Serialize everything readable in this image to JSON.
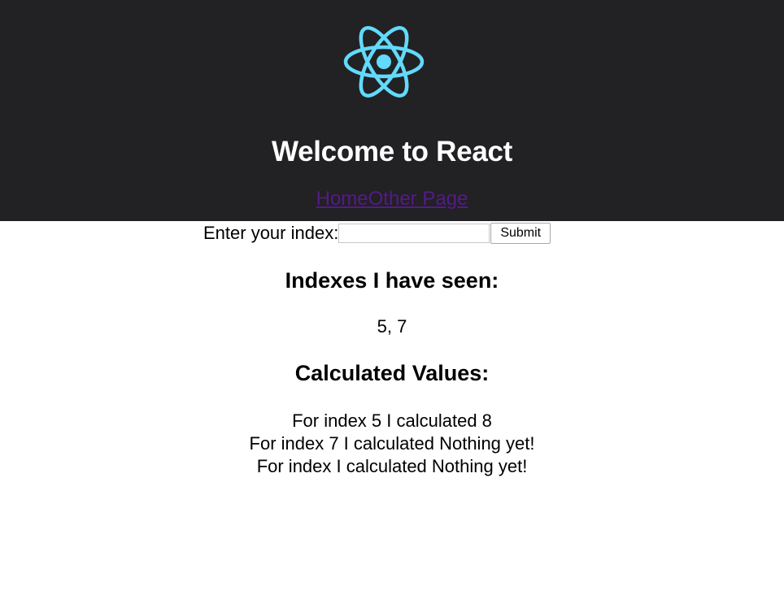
{
  "header": {
    "logo_icon": "react-logo-icon",
    "logo_color": "#61dafb",
    "background_color": "#222123",
    "title": "Welcome to React"
  },
  "nav": {
    "links": [
      "Home",
      "Other Page"
    ],
    "link_color": "#551a8b"
  },
  "form": {
    "label": "Enter your index:",
    "input_value": "",
    "input_placeholder": "",
    "submit_label": "Submit"
  },
  "indexes": {
    "title": "Indexes I have seen:",
    "values": "5, 7"
  },
  "calculated": {
    "title": "Calculated Values:",
    "items": [
      "For index 5 I calculated 8",
      "For index 7 I calculated Nothing yet!",
      "For index I calculated Nothing yet!"
    ]
  }
}
